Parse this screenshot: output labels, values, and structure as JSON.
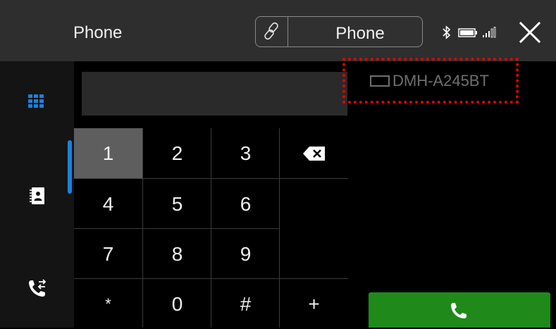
{
  "header": {
    "title": "Phone",
    "source_label": "Phone",
    "icons": {
      "source": "link-icon",
      "bluetooth": "bluetooth-icon",
      "battery": "battery-icon",
      "signal": "signal-icon",
      "close": "close-icon"
    }
  },
  "sidebar": {
    "items": [
      {
        "icon": "keypad-icon",
        "active": true
      },
      {
        "icon": "contacts-icon",
        "active": false
      },
      {
        "icon": "call-history-icon",
        "active": false
      }
    ]
  },
  "display": {
    "number": "",
    "device_name": "DMH-A245BT"
  },
  "keypad": {
    "keys": [
      "1",
      "2",
      "3",
      "4",
      "5",
      "6",
      "7",
      "8",
      "9",
      "*",
      "0",
      "#",
      "+"
    ]
  },
  "colors": {
    "accent": "#1e7fdf",
    "call": "#1f8a1a",
    "highlight": "#e60000"
  }
}
